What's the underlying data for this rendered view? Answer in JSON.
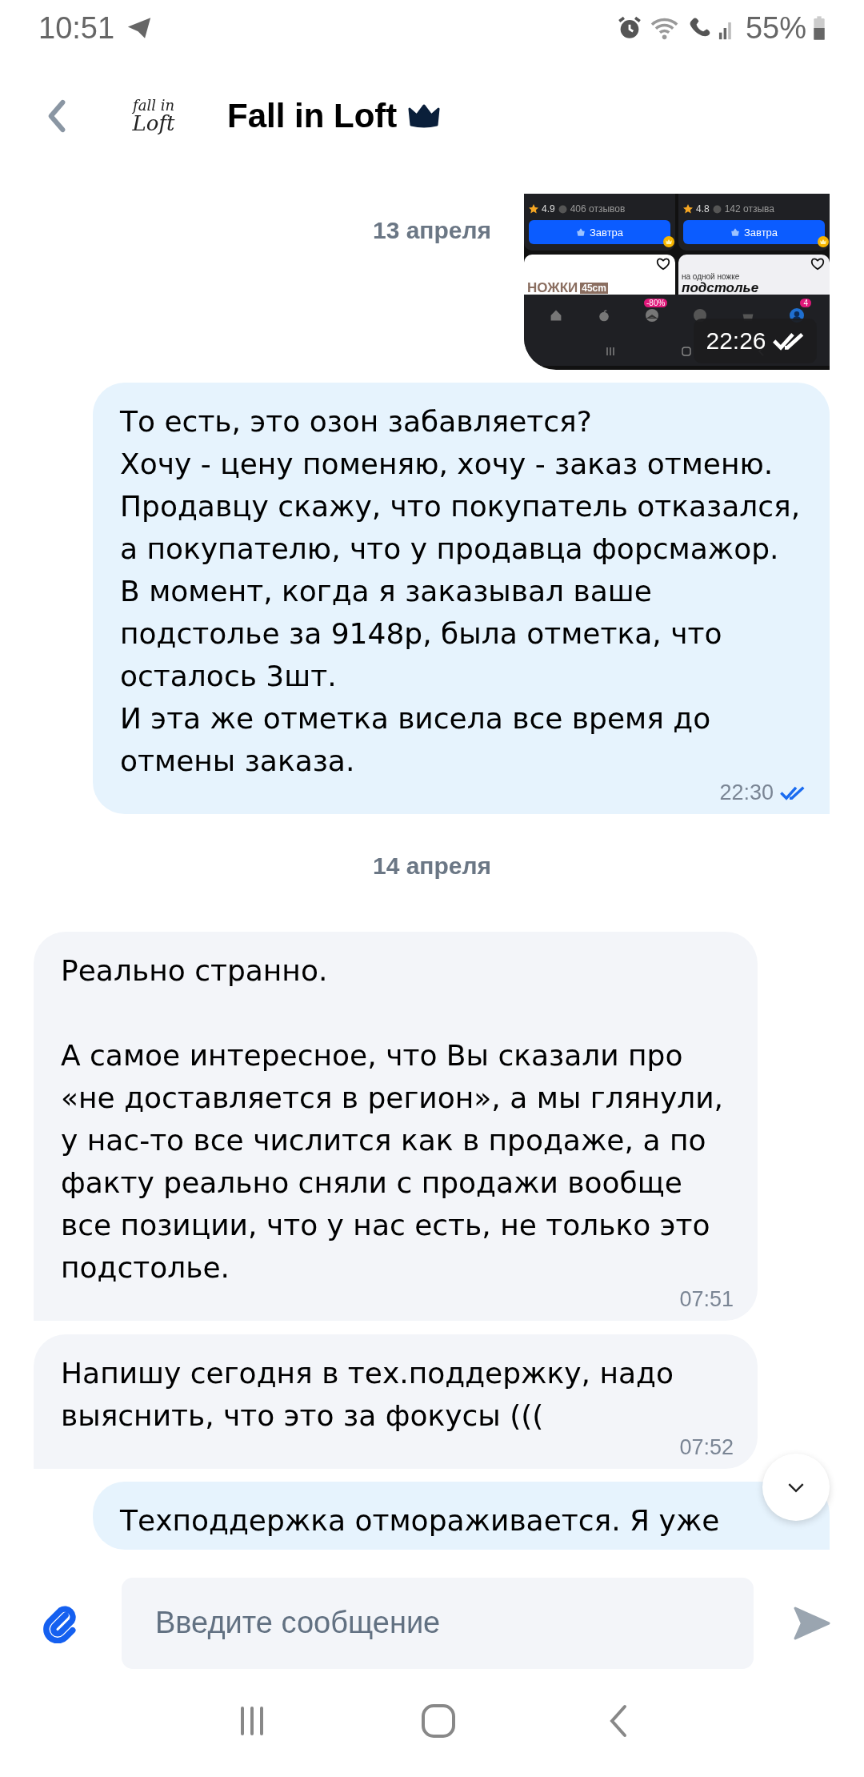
{
  "status_bar": {
    "time": "10:51",
    "battery": "55%"
  },
  "header": {
    "title": "Fall in Loft",
    "avatar": {
      "lines": [
        "fall in",
        "Loft"
      ]
    }
  },
  "messages": [
    {
      "kind": "date",
      "text": "13 апреля",
      "floating": true
    },
    {
      "kind": "image",
      "outgoing": true,
      "time": "22:26",
      "read": true,
      "screenshot": {
        "cards": [
          {
            "rating": "4.9",
            "reviews": "406 отзывов",
            "button": "Завтра"
          },
          {
            "rating": "4.8",
            "reviews": "142 отзыва",
            "button": "Завтра"
          }
        ],
        "tiles": [
          {
            "title": "НОЖКИ",
            "tag": "45cm"
          },
          {
            "subtitle": "на одной ножке",
            "title": "подстолье"
          }
        ],
        "promo_badge": "-80%",
        "profile_badge": "4"
      }
    },
    {
      "kind": "text",
      "outgoing": true,
      "text": "То есть, это озон забавляется?\nХочу - цену поменяю, хочу - заказ отменю. Продавцу скажу, что покупатель отказался, а покупателю, что у продавца форсмажор.\nВ момент, когда я заказывал ваше подстолье за 9148р, была отметка, что осталось 3шт.\nИ эта же отметка висела все время до отмены заказа.",
      "time": "22:30",
      "read": true
    },
    {
      "kind": "date",
      "text": "14 апреля",
      "floating": false
    },
    {
      "kind": "text",
      "outgoing": false,
      "text": "Реально странно.\n\nА самое интересное, что Вы сказали про «не доставляется в регион», а мы глянули, у нас-то все числится как в продаже, а по факту реально сняли с продажи вообще все позиции, что у нас есть, не только это подстолье.",
      "time": "07:51"
    },
    {
      "kind": "text",
      "outgoing": false,
      "text": "Напишу сегодня в тех.поддержку, надо выяснить, что это за фокусы (((",
      "time": "07:52"
    },
    {
      "kind": "text",
      "outgoing": true,
      "text": "Техподдержка отмораживается. Я уже"
    }
  ],
  "composer": {
    "placeholder": "Введите сообщение"
  }
}
